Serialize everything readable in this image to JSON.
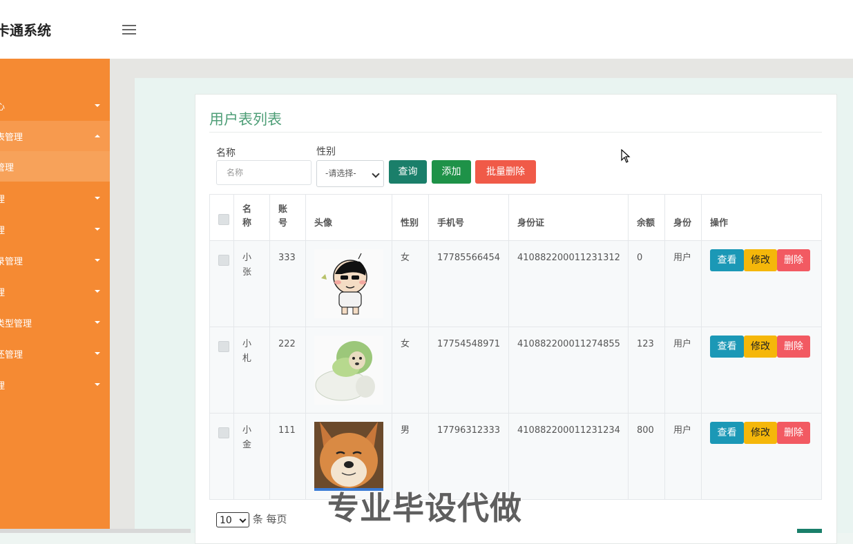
{
  "header": {
    "app_title": "卡通系统",
    "menu_icon": "hamburger-icon"
  },
  "sidebar": {
    "items": [
      {
        "label": "心",
        "expanded": false
      },
      {
        "label": "表管理",
        "expanded": true
      },
      {
        "label": "管理",
        "sub": true
      },
      {
        "label": "理",
        "expanded": false
      },
      {
        "label": "理",
        "expanded": false
      },
      {
        "label": "录管理",
        "expanded": false
      },
      {
        "label": "理",
        "expanded": false
      },
      {
        "label": "类型管理",
        "expanded": false
      },
      {
        "label": "还管理",
        "expanded": false
      },
      {
        "label": "理",
        "expanded": false
      }
    ]
  },
  "page": {
    "title": "用户表列表"
  },
  "search": {
    "name_label": "名称",
    "name_placeholder": "名称",
    "gender_label": "性别",
    "gender_selected": "-请选择-",
    "query_button": "查询",
    "add_button": "添加",
    "batch_delete_button": "批量删除"
  },
  "table": {
    "columns": [
      "名称",
      "账号",
      "头像",
      "性别",
      "手机号",
      "身份证",
      "余额",
      "身份",
      "操作"
    ],
    "col_name_lines": [
      "名",
      "称"
    ],
    "col_account_lines": [
      "账",
      "号"
    ],
    "actions": {
      "view": "查看",
      "edit": "修改",
      "delete": "删除"
    },
    "rows": [
      {
        "name_lines": [
          "小",
          "张"
        ],
        "account": "333",
        "avatar": "cartoon-boy-avatar",
        "gender": "女",
        "phone": "17785566454",
        "id_card": "410882200011231312",
        "balance": "0",
        "role": "用户"
      },
      {
        "name_lines": [
          "小",
          "札"
        ],
        "account": "222",
        "avatar": "cabbage-dog-avatar",
        "gender": "女",
        "phone": "17754548971",
        "id_card": "410882200011274855",
        "balance": "123",
        "role": "用户"
      },
      {
        "name_lines": [
          "小",
          "金"
        ],
        "account": "111",
        "avatar": "shiba-dog-avatar",
        "gender": "男",
        "phone": "17796312333",
        "id_card": "410882200011231234",
        "balance": "800",
        "role": "用户"
      }
    ]
  },
  "pager": {
    "page_size": "10",
    "suffix": "条 每页"
  },
  "watermark": "专业毕设代做",
  "colors": {
    "sidebar": "#f58a33",
    "title": "#4e9e77",
    "query": "#1a7f6a",
    "add": "#1e9248",
    "batch_delete": "#f05a48",
    "view": "#1b98b6",
    "edit": "#f5b70a",
    "delete": "#f25a62"
  }
}
